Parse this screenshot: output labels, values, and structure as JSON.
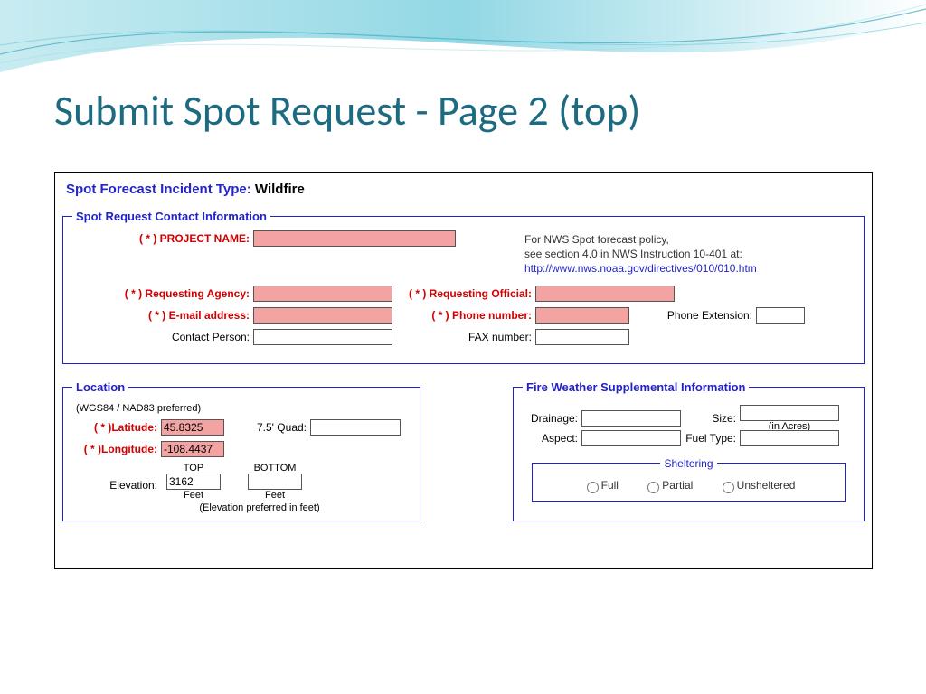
{
  "slide": {
    "title": "Submit Spot Request - Page 2 (top)"
  },
  "incident": {
    "label": "Spot Forecast Incident Type:",
    "value": "Wildfire"
  },
  "contact_fieldset": {
    "legend": "Spot Request Contact Information",
    "project_name_label": "( * ) PROJECT NAME:",
    "policy_line1": "For NWS Spot forecast policy,",
    "policy_line2": "see section 4.0 in NWS Instruction 10-401 at:",
    "policy_link": "http://www.nws.noaa.gov/directives/010/010.htm",
    "requesting_agency_label": "( * ) Requesting Agency:",
    "requesting_official_label": "( * ) Requesting Official:",
    "email_label": "( * ) E-mail address:",
    "phone_label": "( * ) Phone number:",
    "phone_ext_label": "Phone Extension:",
    "contact_person_label": "Contact Person:",
    "fax_label": "FAX number:"
  },
  "location_fieldset": {
    "legend": "Location",
    "note": "(WGS84 / NAD83 preferred)",
    "lat_label": "( * )Latitude:",
    "lat_value": "45.8325",
    "lon_label": "( * )Longitude:",
    "lon_value": "-108.4437",
    "quad_label": "7.5' Quad:",
    "elevation_label": "Elevation:",
    "top_label": "TOP",
    "bottom_label": "BOTTOM",
    "top_value": "3162",
    "bottom_value": "",
    "feet_label": "Feet",
    "elev_note": "(Elevation preferred in feet)"
  },
  "supplemental_fieldset": {
    "legend": "Fire Weather Supplemental Information",
    "drainage_label": "Drainage:",
    "size_label": "Size:",
    "size_unit": "(in Acres)",
    "aspect_label": "Aspect:",
    "fuel_type_label": "Fuel Type:",
    "sheltering_legend": "Sheltering",
    "sheltering_full": "Full",
    "sheltering_partial": "Partial",
    "sheltering_unsheltered": "Unsheltered"
  }
}
